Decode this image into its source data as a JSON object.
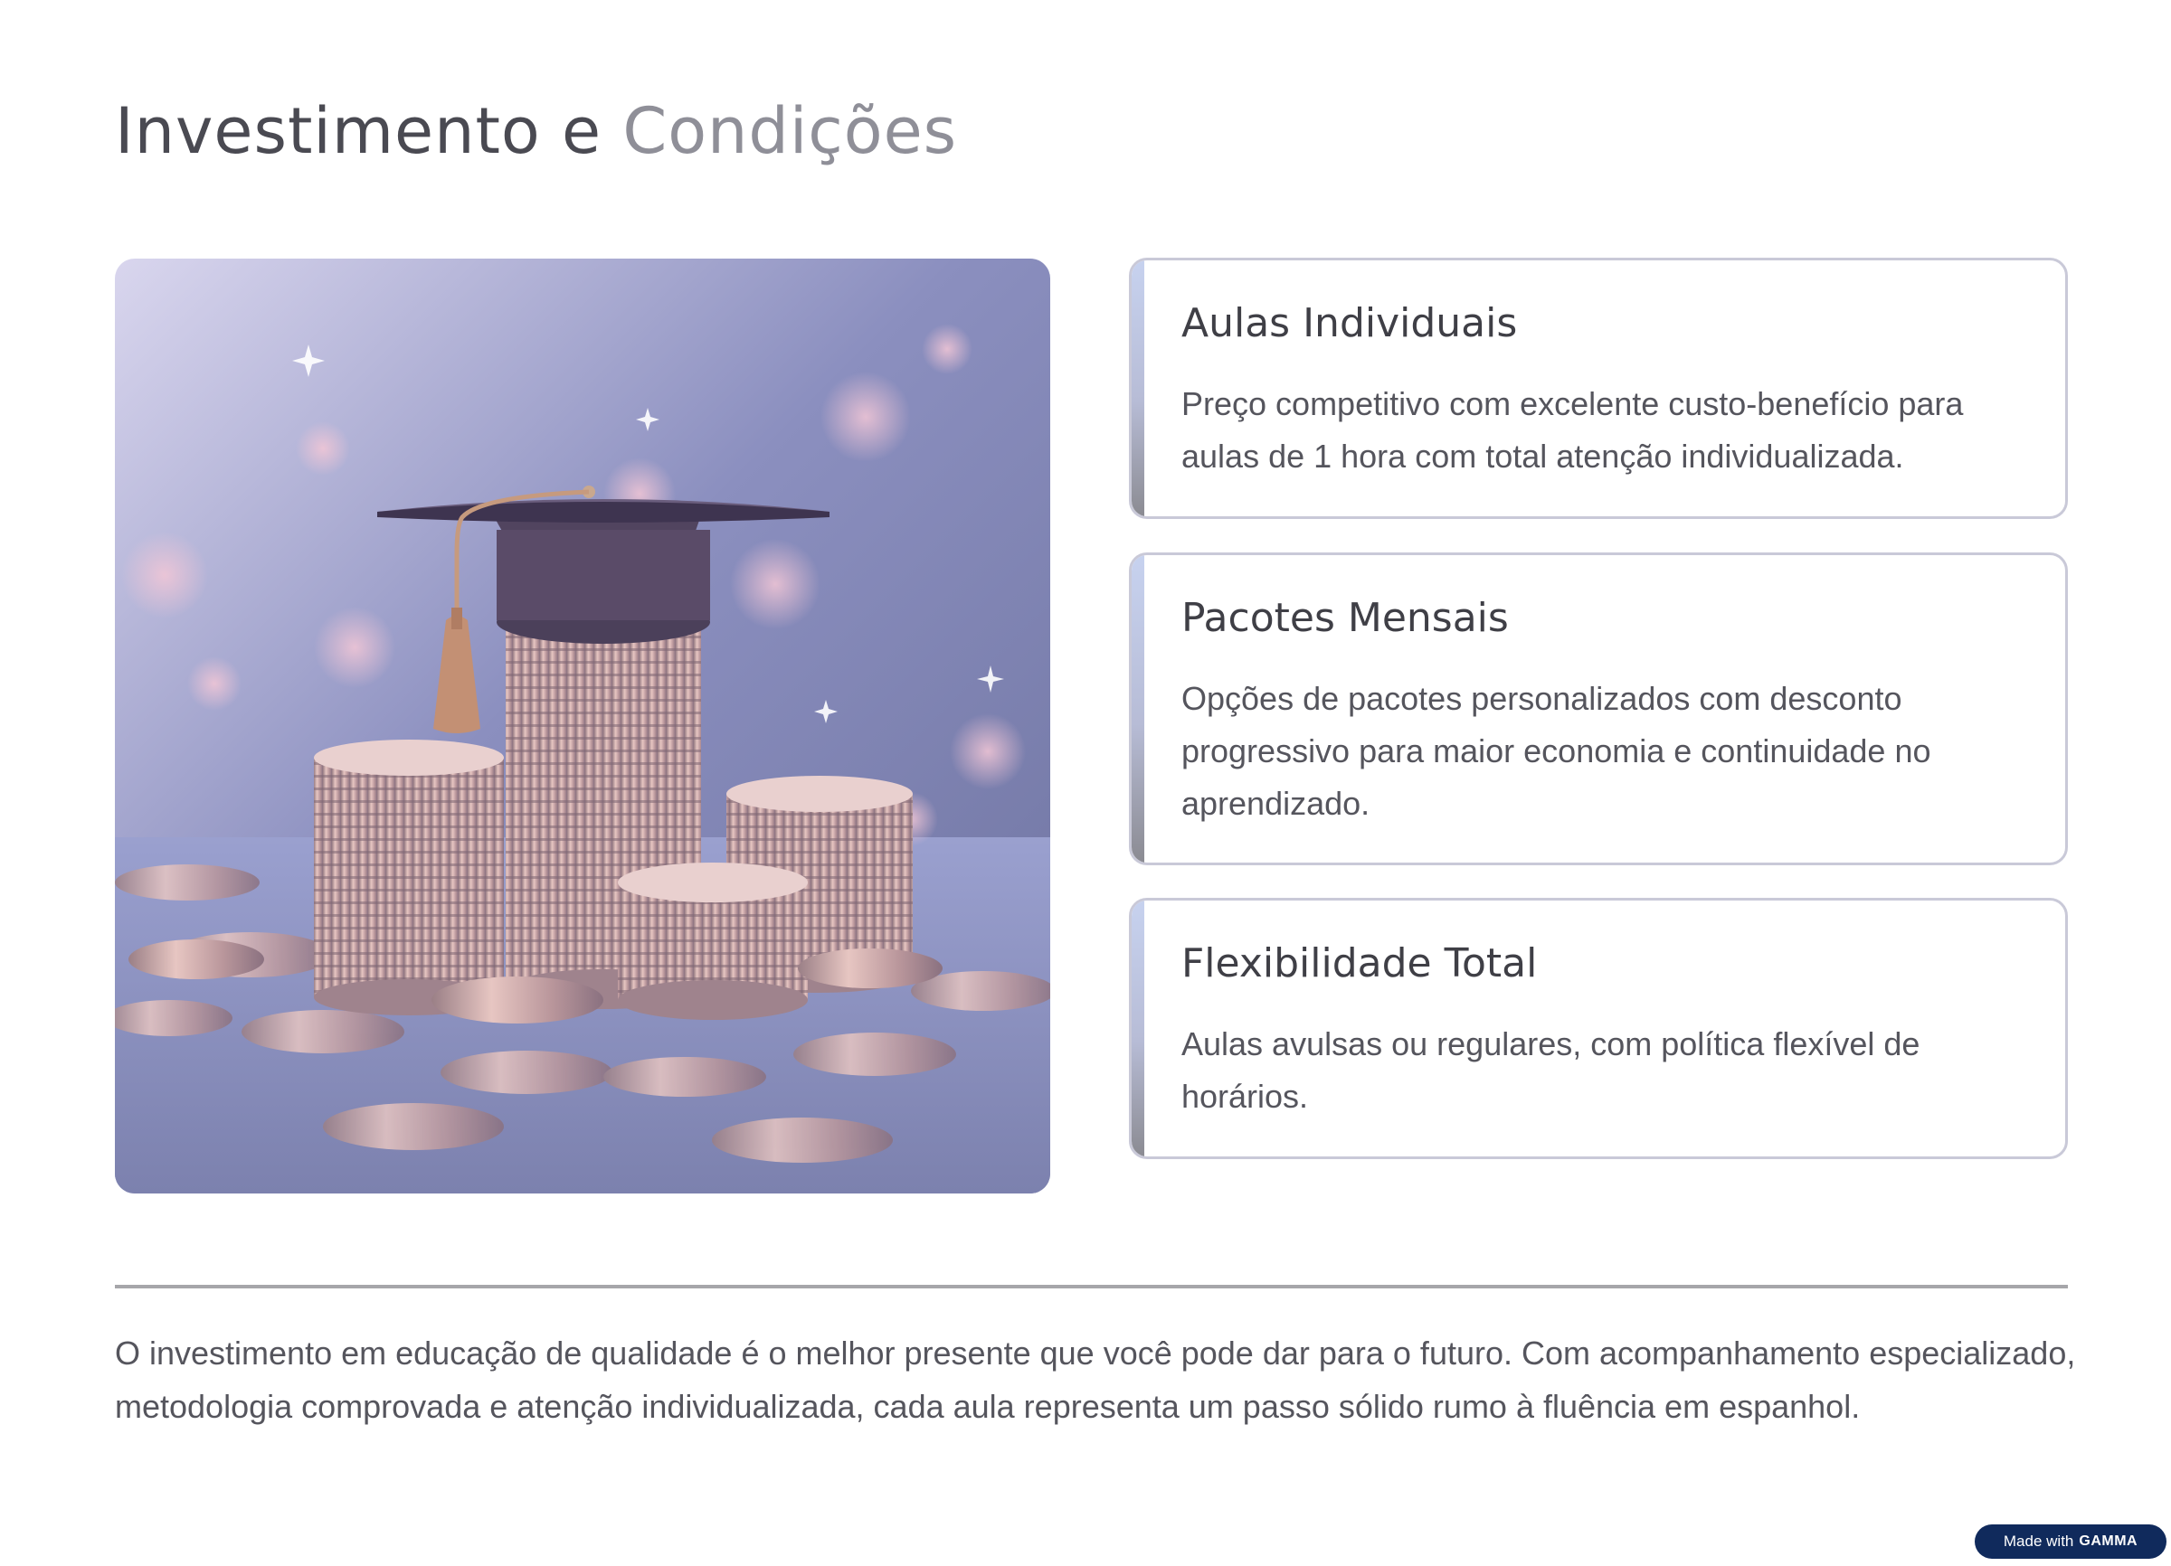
{
  "title": {
    "part1": "Investimento e",
    "part2": "Condições"
  },
  "hero_image": {
    "icon": "graduation-cap-coins-image"
  },
  "cards": [
    {
      "title": "Aulas Individuais",
      "text": "Preço competitivo com excelente custo-benefício para aulas de 1 hora com total atenção individualizada."
    },
    {
      "title": "Pacotes Mensais",
      "text": "Opções de pacotes personalizados com desconto progressivo para maior economia e continuidade no aprendizado."
    },
    {
      "title": "Flexibilidade Total",
      "text": "Aulas avulsas ou regulares, com política flexível de horários."
    }
  ],
  "footer": {
    "text": "O investimento em educação de qualidade é o melhor presente que você pode dar para o futuro. Com acompanhamento especializado, metodologia comprovada e atenção individualizada, cada aula representa um passo sólido rumo à fluência em espanhol."
  },
  "badge": {
    "prefix": "Made with",
    "brand": "GAMMA"
  },
  "colors": {
    "title": "#4a4a52",
    "title_accent": "#8f8f98",
    "card_border": "#c9c9d8",
    "badge_bg": "#102a5c"
  }
}
